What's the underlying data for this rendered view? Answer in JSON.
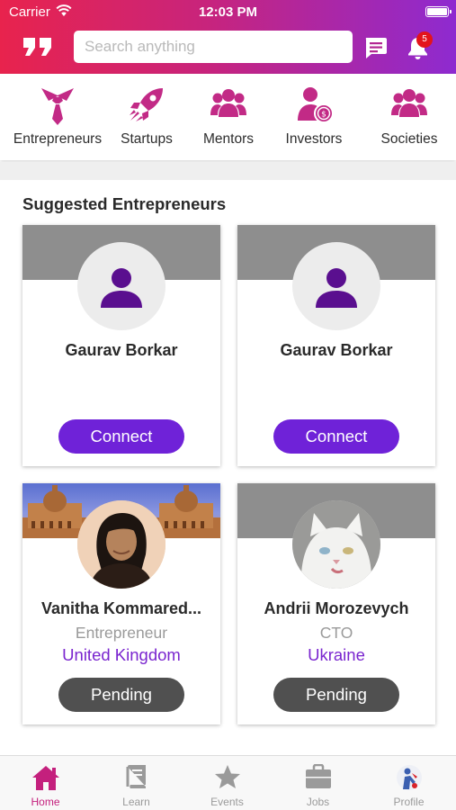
{
  "status_bar": {
    "carrier": "Carrier",
    "time": "12:03 PM"
  },
  "header": {
    "search_placeholder": "Search anything",
    "notification_count": "5"
  },
  "categories": [
    {
      "label": "Entrepreneurs",
      "icon": "tie-icon"
    },
    {
      "label": "Startups",
      "icon": "rocket-icon"
    },
    {
      "label": "Mentors",
      "icon": "group-icon"
    },
    {
      "label": "Investors",
      "icon": "investor-icon"
    },
    {
      "label": "Societies",
      "icon": "group-icon"
    }
  ],
  "section_title": "Suggested Entrepreneurs",
  "cards": [
    {
      "name": "Gaurav Borkar",
      "role": "",
      "country": "",
      "action": "Connect"
    },
    {
      "name": "Gaurav Borkar",
      "role": "",
      "country": "",
      "action": "Connect"
    },
    {
      "name": "Vanitha Kommared...",
      "role": "Entrepreneur",
      "country": "United Kingdom",
      "action": "Pending"
    },
    {
      "name": "Andrii Morozevych",
      "role": "CTO",
      "country": "Ukraine",
      "action": "Pending"
    }
  ],
  "bottom_nav": [
    {
      "label": "Home",
      "icon": "home-icon",
      "active": true
    },
    {
      "label": "Learn",
      "icon": "book-icon",
      "active": false
    },
    {
      "label": "Events",
      "icon": "star-icon",
      "active": false
    },
    {
      "label": "Jobs",
      "icon": "briefcase-icon",
      "active": false
    },
    {
      "label": "Profile",
      "icon": "profile-icon",
      "active": false
    }
  ],
  "colors": {
    "header_gradient": [
      "#e8234d",
      "#c8247c",
      "#8e2ad0"
    ],
    "accent_magenta": "#c4207d",
    "connect_button": "#6f22d8",
    "pending_button": "#505050",
    "country_text": "#7a25cf"
  }
}
